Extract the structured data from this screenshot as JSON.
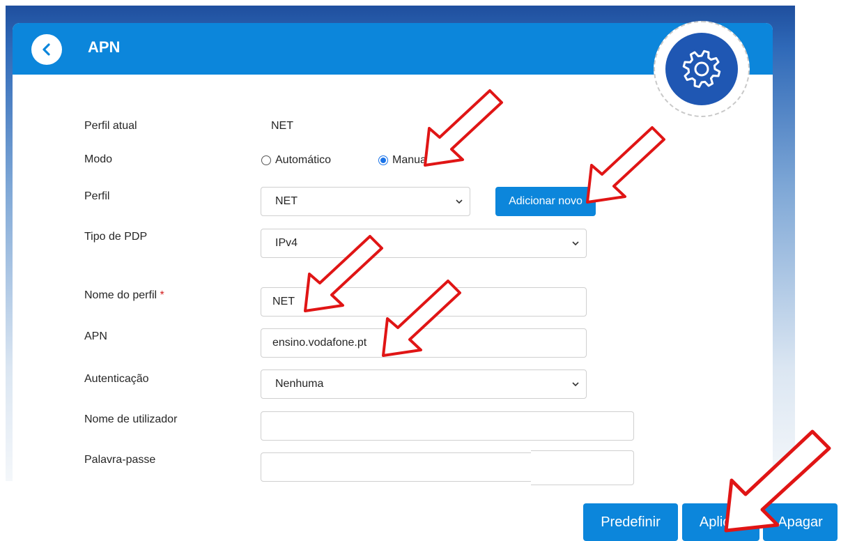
{
  "header": {
    "title": "APN"
  },
  "form": {
    "current_profile_label": "Perfil atual",
    "current_profile_value": "NET",
    "mode_label": "Modo",
    "mode_options": [
      "Automático",
      "Manual"
    ],
    "mode_selected": "Manual",
    "profile_label": "Perfil",
    "profile_selected": "NET",
    "add_new_label": "Adicionar novo",
    "pdp_type_label": "Tipo de PDP",
    "pdp_type_selected": "IPv4",
    "profile_name_label": "Nome do perfil",
    "required_marker": "*",
    "profile_name_value": "NET",
    "apn_label": "APN",
    "apn_value": "ensino.vodafone.pt",
    "auth_label": "Autenticação",
    "auth_selected": "Nenhuma",
    "username_label": "Nome de utilizador",
    "username_value": "",
    "password_label": "Palavra-passe",
    "password_value": ""
  },
  "actions": {
    "reset_label": "Predefinir",
    "apply_label": "Aplicar",
    "delete_label": "Apagar"
  },
  "icons": {
    "back": "chevron-left-icon",
    "settings": "gear-icon",
    "dropdown": "chevron-down-icon",
    "annotation": "red-arrow-annotation"
  },
  "colors": {
    "header_blue": "#0c86db",
    "gear_blue": "#1f57b3",
    "arrow_red": "#e01515",
    "required_red": "#d21f1f"
  }
}
